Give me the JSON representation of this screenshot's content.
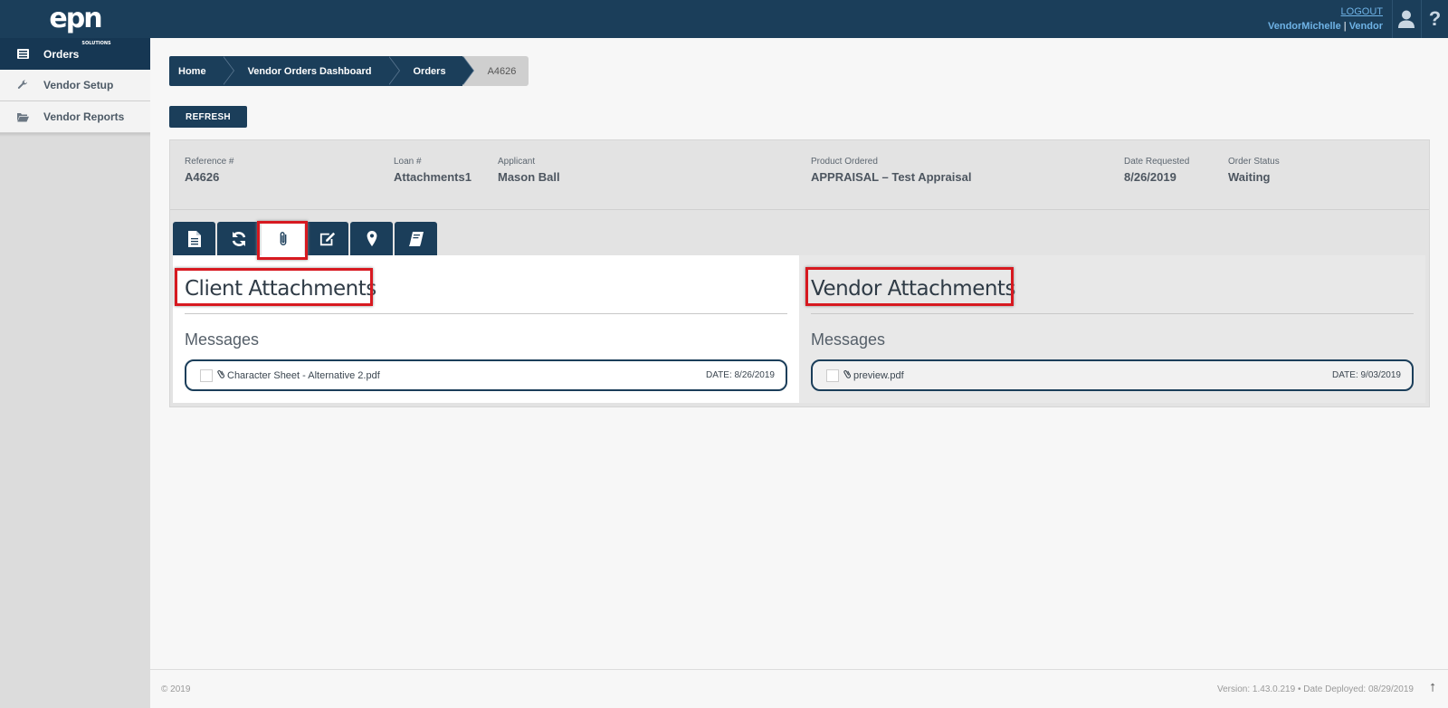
{
  "logo": {
    "text": "epn",
    "sub": "SOLUTIONS"
  },
  "sidebar": {
    "items": [
      {
        "label": "Orders",
        "icon": "list-icon",
        "active": true
      },
      {
        "label": "Vendor Setup",
        "icon": "wrench-icon",
        "active": false
      },
      {
        "label": "Vendor Reports",
        "icon": "folder-open-icon",
        "active": false
      }
    ]
  },
  "header": {
    "logout": "LOGOUT",
    "user": "VendorMichelle",
    "separator": "|",
    "role": "Vendor",
    "help_glyph": "?"
  },
  "breadcrumb": [
    "Home",
    "Vendor Orders Dashboard",
    "Orders",
    "A4626"
  ],
  "refresh_label": "REFRESH",
  "order": {
    "reference": {
      "label": "Reference #",
      "value": "A4626"
    },
    "loan": {
      "label": "Loan #",
      "value": "Attachments1"
    },
    "applicant": {
      "label": "Applicant",
      "value": "Mason Ball"
    },
    "product": {
      "label": "Product Ordered",
      "value": "APPRAISAL – Test Appraisal"
    },
    "date_requested": {
      "label": "Date Requested",
      "value": "8/26/2019"
    },
    "status": {
      "label": "Order Status",
      "value": "Waiting"
    }
  },
  "tabs": [
    {
      "icon": "document-icon",
      "active": false
    },
    {
      "icon": "refresh-icon",
      "active": false
    },
    {
      "icon": "paperclip-icon",
      "active": true
    },
    {
      "icon": "edit-icon",
      "active": false
    },
    {
      "icon": "map-marker-icon",
      "active": false
    },
    {
      "icon": "book-icon",
      "active": false
    }
  ],
  "client": {
    "title": "Client Attachments",
    "messages": "Messages",
    "file": {
      "name": "Character Sheet - Alternative 2.pdf",
      "date": "DATE: 8/26/2019"
    }
  },
  "vendor": {
    "title": "Vendor Attachments",
    "messages": "Messages",
    "file": {
      "name": "preview.pdf",
      "date": "DATE: 9/03/2019"
    }
  },
  "footer": {
    "copyright": "© 2019",
    "version": "Version: 1.43.0.219  •  Date Deployed: 08/29/2019",
    "up_arrow": "⭡"
  },
  "colors": {
    "navy": "#1b3e5a",
    "highlight": "#d71920",
    "link": "#6fb3e6"
  }
}
